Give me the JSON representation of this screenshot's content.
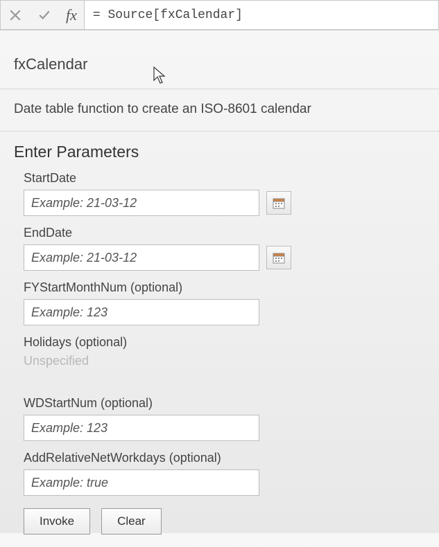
{
  "formulaBar": {
    "expression": "= Source[fxCalendar]"
  },
  "function": {
    "name": "fxCalendar",
    "description": "Date table function to create an ISO-8601 calendar"
  },
  "parametersHeading": "Enter Parameters",
  "params": {
    "startDate": {
      "label": "StartDate",
      "placeholder": "Example: 21-03-12"
    },
    "endDate": {
      "label": "EndDate",
      "placeholder": "Example: 21-03-12"
    },
    "fyStartMonthNum": {
      "label": "FYStartMonthNum (optional)",
      "placeholder": "Example: 123"
    },
    "holidays": {
      "label": "Holidays (optional)",
      "unspecified": "Unspecified"
    },
    "wdStartNum": {
      "label": "WDStartNum (optional)",
      "placeholder": "Example: 123"
    },
    "addRelativeNetWorkdays": {
      "label": "AddRelativeNetWorkdays (optional)",
      "placeholder": "Example: true"
    }
  },
  "buttons": {
    "invoke": "Invoke",
    "clear": "Clear"
  }
}
